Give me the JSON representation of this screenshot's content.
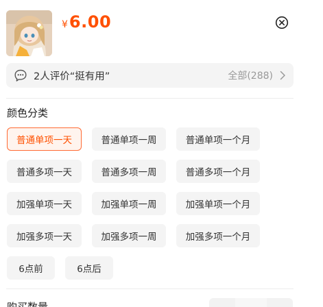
{
  "product": {
    "currency_symbol": "¥",
    "price": "6.00"
  },
  "review": {
    "summary": "2人评价“挺有用”",
    "all_label": "全部(288)"
  },
  "spec": {
    "section_title": "颜色分类",
    "options": [
      "普通单项一天",
      "普通单项一周",
      "普通单项一个月",
      "普通多项一天",
      "普通多项一周",
      "普通多项一个月",
      "加强单项一天",
      "加强单项一周",
      "加强单项一个月",
      "加强多项一天",
      "加强多项一周",
      "加强多项一个月",
      "6点前",
      "6点后"
    ],
    "selected": "普通单项一天"
  },
  "quantity": {
    "label": "购买数量"
  },
  "icons": {
    "close": "close-circle-icon",
    "chat": "chat-bubble-icon",
    "chevron": "chevron-right-icon"
  },
  "colors": {
    "accent": "#ff5000",
    "chip_bg": "#f4f4f4",
    "selected_bg": "#fff4ee"
  }
}
